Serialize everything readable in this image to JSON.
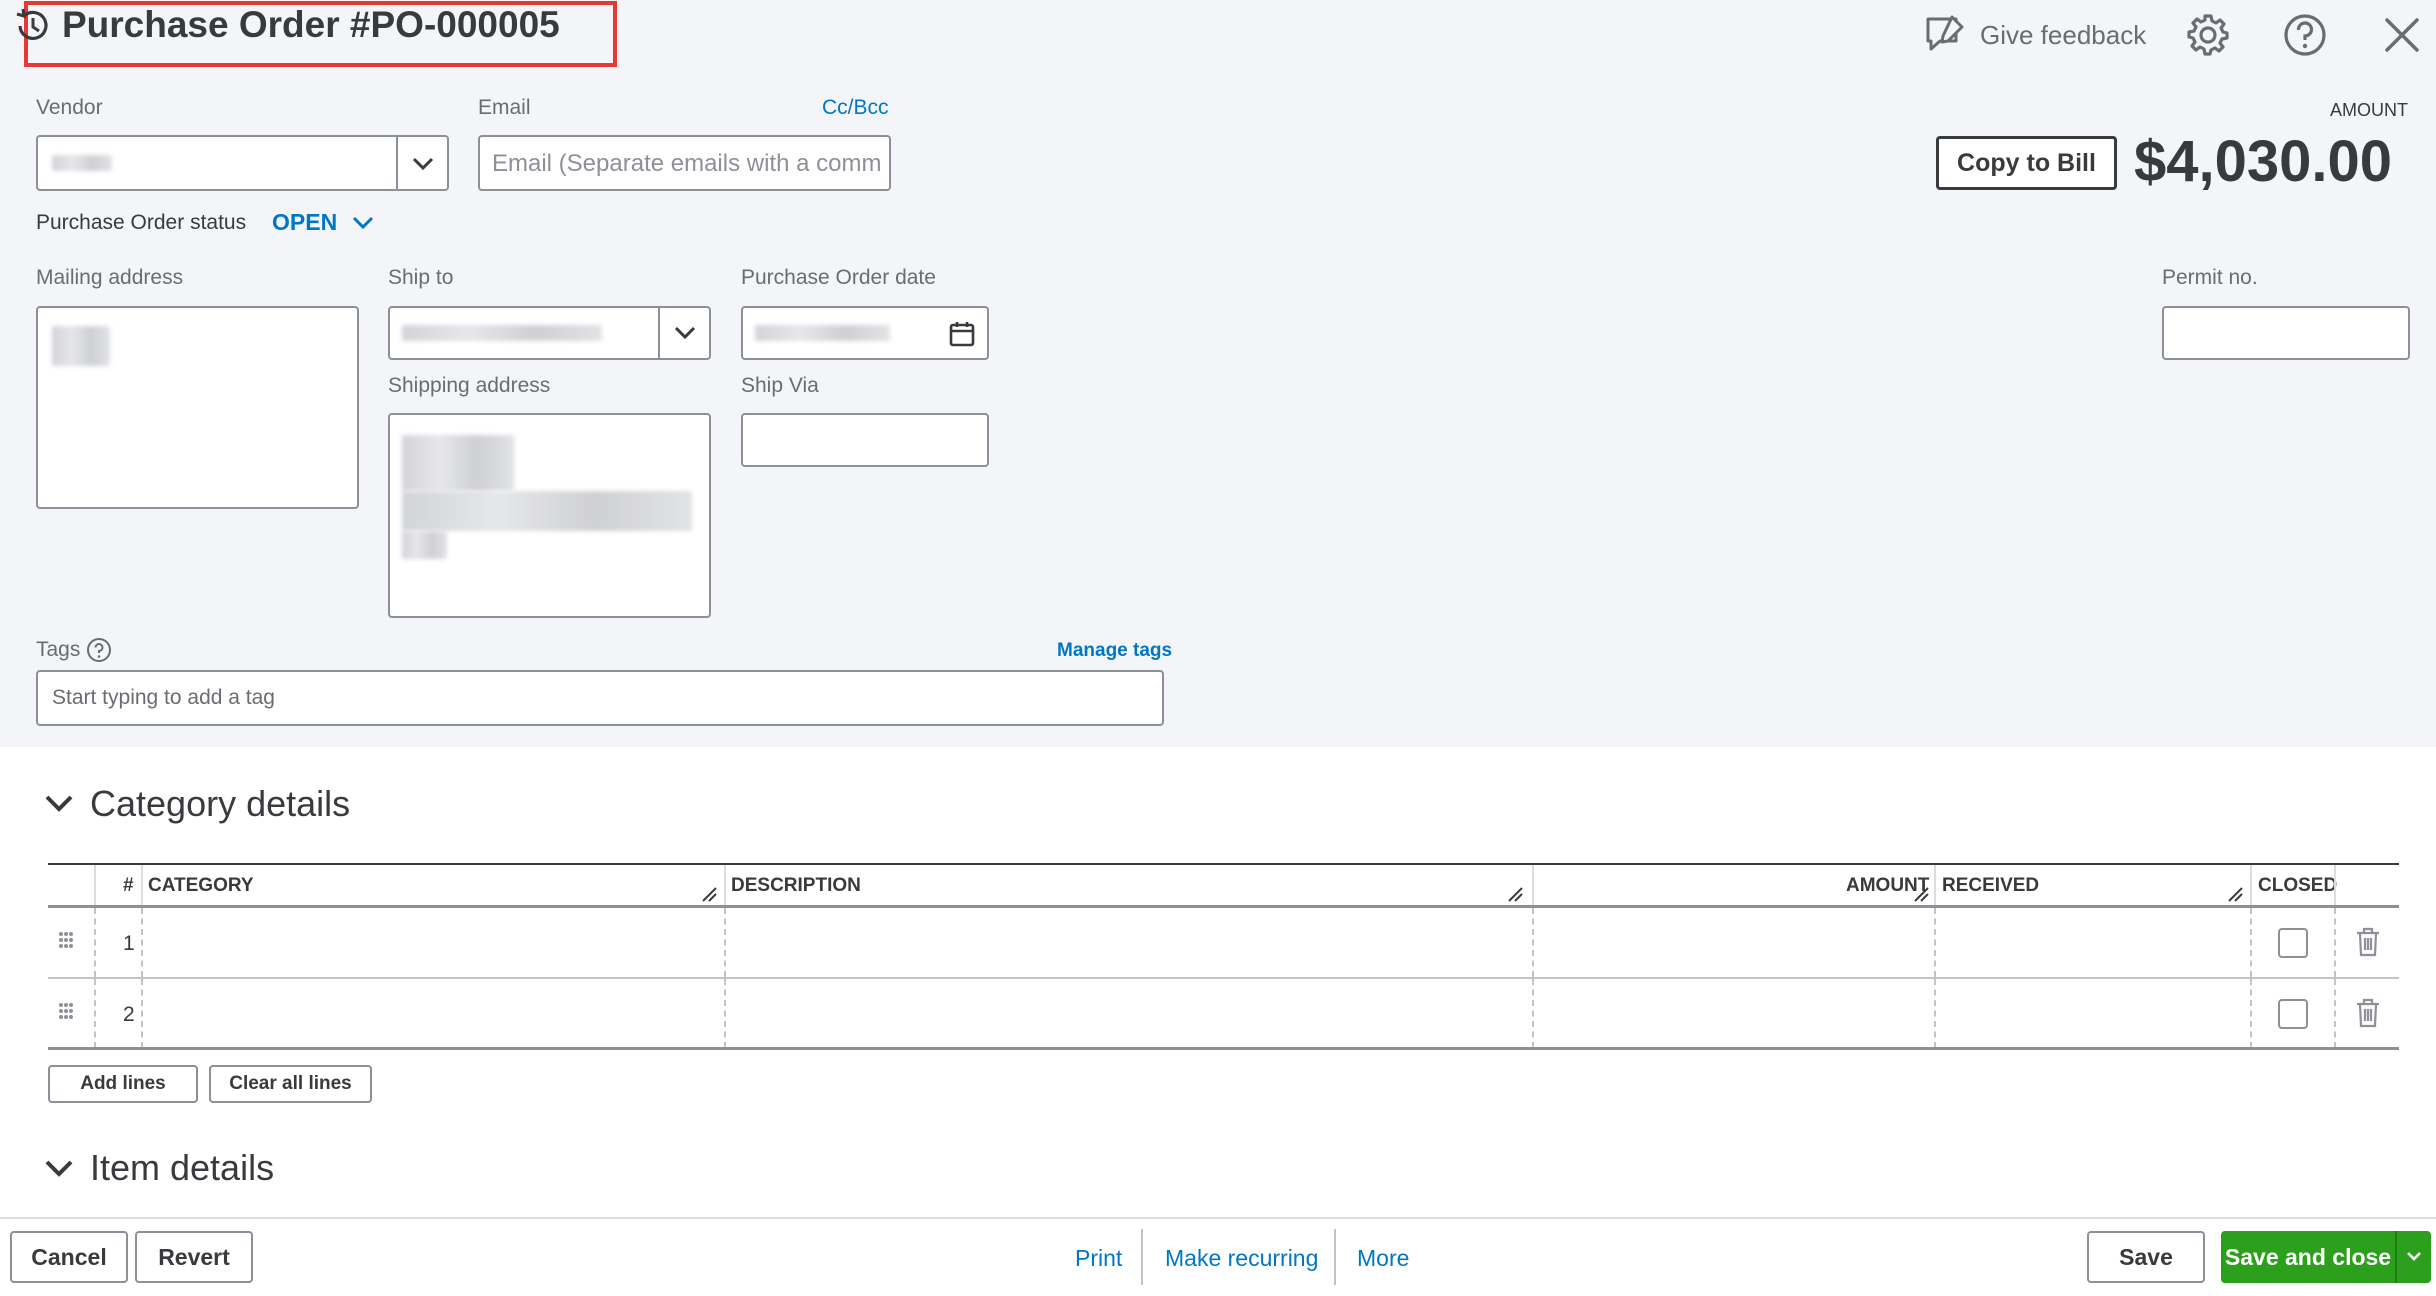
{
  "header": {
    "title": "Purchase Order #PO-000005",
    "feedback_label": "Give feedback"
  },
  "vendor": {
    "label": "Vendor"
  },
  "email": {
    "label": "Email",
    "ccbcc": "Cc/Bcc",
    "placeholder": "Email (Separate emails with a comm"
  },
  "status": {
    "label": "Purchase Order status",
    "value": "OPEN"
  },
  "amount": {
    "label": "AMOUNT",
    "value": "$4,030.00",
    "copy_to_bill": "Copy to Bill"
  },
  "fields": {
    "mailing_address": "Mailing address",
    "ship_to": "Ship to",
    "po_date": "Purchase Order date",
    "shipping_address": "Shipping address",
    "ship_via": "Ship Via",
    "permit_no": "Permit no."
  },
  "tags": {
    "label": "Tags",
    "manage": "Manage tags",
    "placeholder": "Start typing to add a tag"
  },
  "category_details": {
    "title": "Category details",
    "columns": [
      "#",
      "CATEGORY",
      "DESCRIPTION",
      "AMOUNT",
      "RECEIVED",
      "CLOSED"
    ],
    "rows": [
      {
        "num": "1",
        "closed": false
      },
      {
        "num": "2",
        "closed": false
      }
    ],
    "add_lines": "Add lines",
    "clear_lines": "Clear all lines"
  },
  "item_details": {
    "title": "Item details"
  },
  "footer": {
    "cancel": "Cancel",
    "revert": "Revert",
    "print": "Print",
    "make_recurring": "Make recurring",
    "more": "More",
    "save": "Save",
    "save_and_close": "Save and close"
  },
  "colors": {
    "accent_link": "#0077c5",
    "primary_green": "#2ca01c",
    "highlight_red": "#e53935"
  }
}
